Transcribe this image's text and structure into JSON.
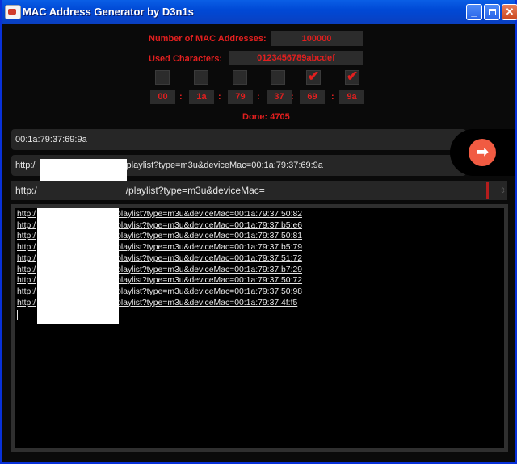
{
  "window": {
    "title": "MAC Address Generator by D3n1s",
    "minimize_glyph": "_",
    "close_glyph": "✕"
  },
  "generator": {
    "count_label": "Number of MAC Addresses:",
    "count_value": "100000",
    "chars_label": "Used Characters:",
    "chars_value": "0123456789abcdef",
    "checkboxes": [
      false,
      false,
      false,
      false,
      true,
      true
    ],
    "check_glyph": "✔",
    "octets": [
      "00",
      "1a",
      "79",
      "37",
      "69",
      "9a"
    ],
    "separator": ":",
    "done_text": "Done: 4705"
  },
  "fields": {
    "current_mac": "00:1a:79:37:69:9a",
    "current_url_prefix": "http:/",
    "current_url_suffix": "/playlist?type=m3u&deviceMac=00:1a:79:37:69:9a",
    "template_prefix": "http:/",
    "template_suffix": "/playlist?type=m3u&deviceMac=",
    "dropdown_arrow": "⇕"
  },
  "go_button": {
    "glyph": "➡"
  },
  "results": {
    "prefix": "http:/",
    "lines": [
      "playlist?type=m3u&deviceMac=00:1a:79:37:50:82",
      "playlist?type=m3u&deviceMac=00:1a:79:37:b5:e6",
      "playlist?type=m3u&deviceMac=00:1a:79:37:50:81",
      "playlist?type=m3u&deviceMac=00:1a:79:37:b5:79",
      "playlist?type=m3u&deviceMac=00:1a:79:37:51:72",
      "playlist?type=m3u&deviceMac=00:1a:79:37:b7:29",
      "playlist?type=m3u&deviceMac=00:1a:79:37:50:72",
      "playlist?type=m3u&deviceMac=00:1a:79:37:50:98",
      "playlist?type=m3u&deviceMac=00:1a:79:37:4f:f5"
    ]
  },
  "colors": {
    "accent": "#e21f1f",
    "titlebar": "#0049d6",
    "go": "#f15b42"
  }
}
